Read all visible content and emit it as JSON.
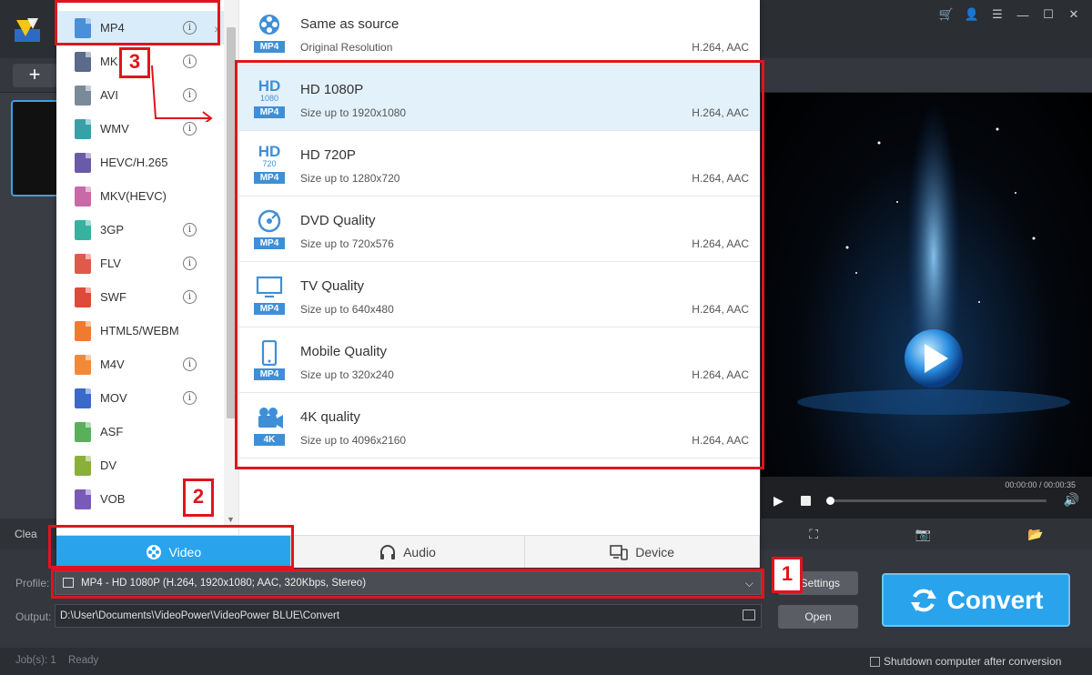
{
  "window": {
    "logo": "app-logo",
    "controls": [
      "cart-icon",
      "user-icon",
      "menu-icon",
      "minimize-icon",
      "maximize-icon",
      "close-icon"
    ]
  },
  "toolbar": {
    "add_label": "+"
  },
  "player": {
    "time": "00:00:00 / 00:00:35"
  },
  "strip": {
    "clear_label": "Clea"
  },
  "bottom": {
    "profile_label": "Profile:",
    "profile_value": "MP4 - HD 1080P (H.264, 1920x1080; AAC, 320Kbps, Stereo)",
    "output_label": "Output:",
    "output_value": "D:\\User\\Documents\\VideoPower\\VideoPower BLUE\\Convert",
    "settings_label": "Settings",
    "open_label": "Open",
    "convert_label": "Convert"
  },
  "status": {
    "jobs": "Job(s): 1",
    "state": "Ready",
    "shutdown_label": "Shutdown computer after conversion"
  },
  "formats": [
    {
      "label": "MP4",
      "info": true,
      "selected": true,
      "color": "#4a90d9"
    },
    {
      "label": "MK",
      "info": true,
      "color": "#5b6a8a"
    },
    {
      "label": "AVI",
      "info": true,
      "color": "#7a8a9a"
    },
    {
      "label": "WMV",
      "info": true,
      "color": "#3aa0a8"
    },
    {
      "label": "HEVC/H.265",
      "info": false,
      "color": "#6b5aa8"
    },
    {
      "label": "MKV(HEVC)",
      "info": false,
      "color": "#c86aa8"
    },
    {
      "label": "3GP",
      "info": true,
      "color": "#3ab0a0"
    },
    {
      "label": "FLV",
      "info": true,
      "color": "#e05a4a"
    },
    {
      "label": "SWF",
      "info": true,
      "color": "#e0483a"
    },
    {
      "label": "HTML5/WEBM",
      "info": false,
      "color": "#f07a30"
    },
    {
      "label": "M4V",
      "info": true,
      "color": "#f08a3a"
    },
    {
      "label": "MOV",
      "info": true,
      "color": "#3a6ac8"
    },
    {
      "label": "ASF",
      "info": false,
      "color": "#5ab05a"
    },
    {
      "label": "DV",
      "info": false,
      "color": "#8ab03a"
    },
    {
      "label": "VOB",
      "info": false,
      "color": "#7a5ab8"
    }
  ],
  "presets": [
    {
      "title": "Same as source",
      "sub": "Original Resolution",
      "codec": "H.264, AAC",
      "glyph": "film-reel",
      "badge": "MP4"
    },
    {
      "title": "HD 1080P",
      "sub": "Size up to 1920x1080",
      "codec": "H.264, AAC",
      "glyph": "HD",
      "glyph_sub": "1080",
      "badge": "MP4",
      "selected": true
    },
    {
      "title": "HD 720P",
      "sub": "Size up to 1280x720",
      "codec": "H.264, AAC",
      "glyph": "HD",
      "glyph_sub": "720",
      "badge": "MP4"
    },
    {
      "title": "DVD Quality",
      "sub": "Size up to 720x576",
      "codec": "H.264, AAC",
      "glyph": "disc",
      "badge": "MP4"
    },
    {
      "title": "TV Quality",
      "sub": "Size up to 640x480",
      "codec": "H.264, AAC",
      "glyph": "tv",
      "badge": "MP4"
    },
    {
      "title": "Mobile Quality",
      "sub": "Size up to 320x240",
      "codec": "H.264, AAC",
      "glyph": "phone",
      "badge": "MP4"
    },
    {
      "title": "4K quality",
      "sub": "Size up to 4096x2160",
      "codec": "H.264, AAC",
      "glyph": "camera",
      "badge": "4K"
    }
  ],
  "tabs": [
    {
      "label": "Video",
      "icon": "film-reel-icon",
      "active": true
    },
    {
      "label": "Audio",
      "icon": "headphones-icon"
    },
    {
      "label": "Device",
      "icon": "device-icon"
    }
  ],
  "annotations": [
    "1",
    "2",
    "3"
  ],
  "colors": {
    "accent": "#29a3ec",
    "annotation": "#e0141e",
    "preset_icon": "#3f8fd6"
  }
}
